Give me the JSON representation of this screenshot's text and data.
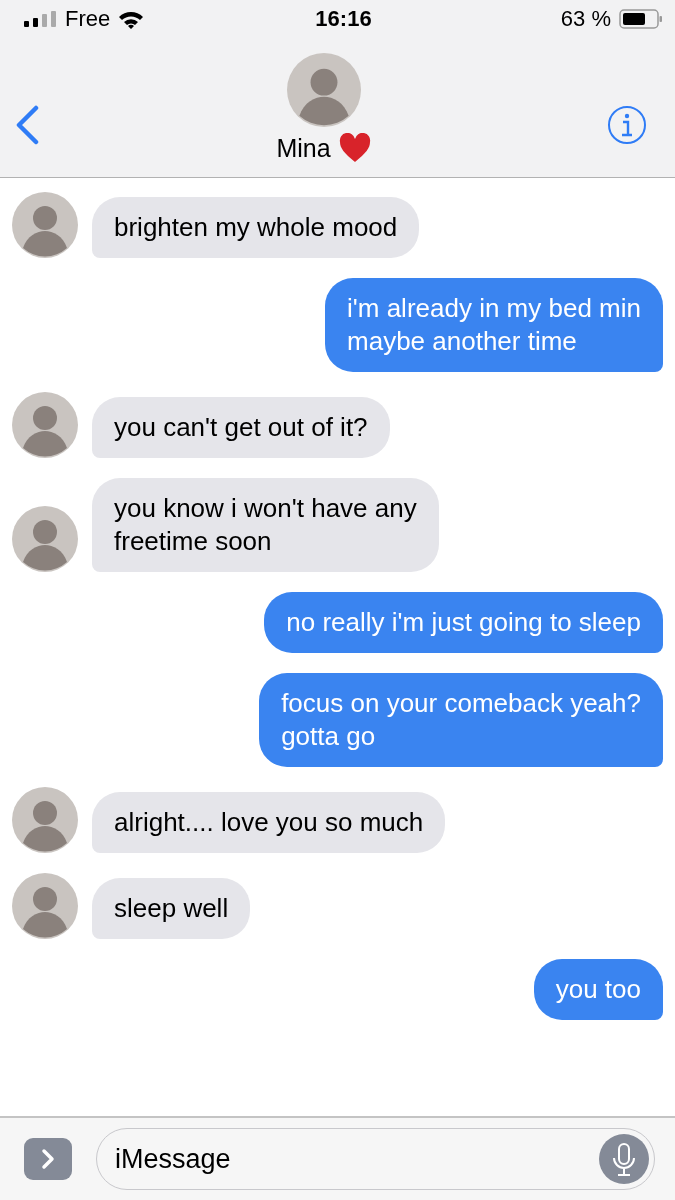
{
  "status_bar": {
    "carrier": "Free",
    "time": "16:16",
    "battery": "63 %"
  },
  "header": {
    "title": "Mina"
  },
  "messages": [
    {
      "kind": "received",
      "text": "brighten my whole mood"
    },
    {
      "kind": "sent",
      "text": "i'm already in my bed min\nmaybe another time"
    },
    {
      "kind": "received",
      "text": "you can't get out of it?"
    },
    {
      "kind": "received",
      "text": "you know i won't have any\nfreetime soon"
    },
    {
      "kind": "sent",
      "text": "no really i'm just going to sleep"
    },
    {
      "kind": "sent",
      "text": "focus on your comeback yeah?\ngotta go"
    },
    {
      "kind": "received",
      "text": "alright.... love you so much"
    },
    {
      "kind": "received",
      "text": "sleep well"
    },
    {
      "kind": "sent",
      "text": "you too"
    }
  ],
  "composer": {
    "placeholder": "iMessage"
  }
}
